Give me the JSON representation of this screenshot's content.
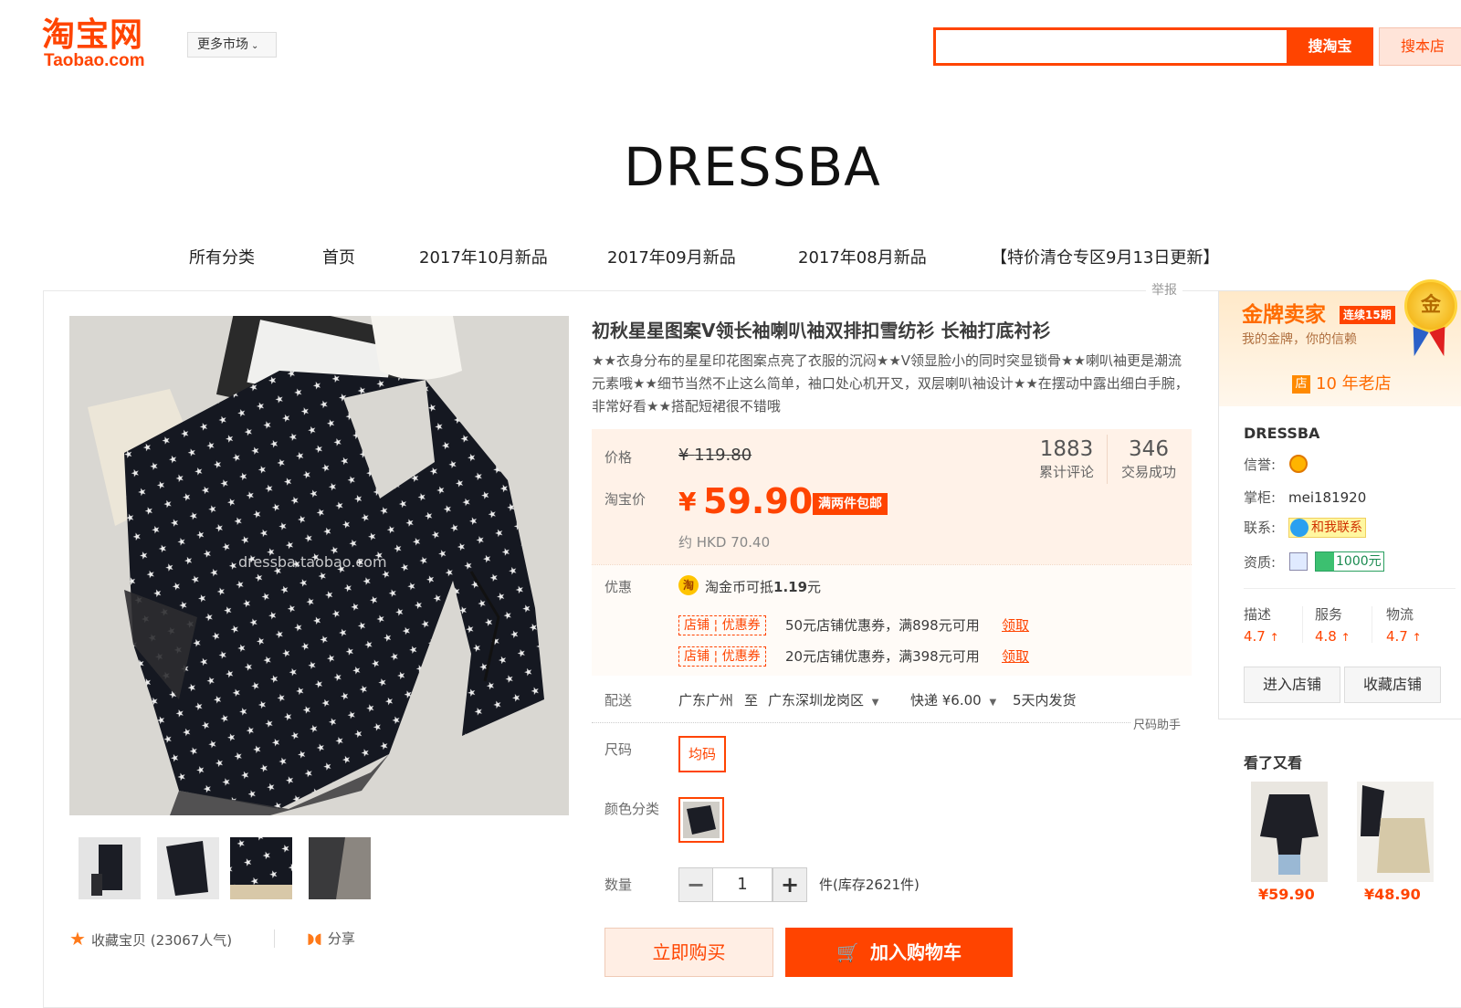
{
  "header": {
    "logo_cn": "淘宝网",
    "logo_en": "Taobao.com",
    "market_label": "更多市场",
    "search_value": "",
    "search_button": "搜淘宝",
    "search_shop_button": "搜本店"
  },
  "store": {
    "name": "DRESSBA",
    "nav": [
      "所有分类",
      "首页",
      "2017年10月新品",
      "2017年09月新品",
      "2017年08月新品",
      "【特价清仓专区9月13日更新】"
    ]
  },
  "report": "举报",
  "gallery": {
    "watermark": "dressba.taobao.com",
    "favorite_label": "收藏宝贝",
    "favorite_count": "(23067人气)",
    "share_label": "分享"
  },
  "product": {
    "title": "初秋星星图案V领长袖喇叭袖双排扣雪纺衫 长袖打底衬衫",
    "subtitle": "★★衣身分布的星星印花图案点亮了衣服的沉闷★★V领显脸小的同时突显锁骨★★喇叭袖更是潮流元素哦★★细节当然不止这么简单，袖口处心机开叉，双层喇叭袖设计★★在摆动中露出细白手腕，非常好看★★搭配短裙很不错哦",
    "price_label": "价格",
    "orig_currency": "¥",
    "orig_price": "119.80",
    "tb_price_label": "淘宝价",
    "currency": "¥",
    "price": "59.90",
    "free_ship_tag": "满两件包邮",
    "hkd": "约 HKD 70.40",
    "reviews_count": "1883",
    "reviews_label": "累计评论",
    "sales_count": "346",
    "sales_label": "交易成功",
    "promo_label": "优惠",
    "coin_icon_text": "淘",
    "coin_text_pre": "淘金币可抵",
    "coin_amount": "1.19",
    "coin_text_post": "元",
    "coupons": [
      {
        "tag_a": "店铺",
        "tag_b": "优惠券",
        "text": "50元店铺优惠券，满898元可用",
        "action": "领取"
      },
      {
        "tag_a": "店铺",
        "tag_b": "优惠券",
        "text": "20元店铺优惠券，满398元可用",
        "action": "领取"
      }
    ],
    "ship_label": "配送",
    "ship_from": "广东广州",
    "ship_to_word": "至",
    "ship_to": "广东深圳龙岗区",
    "ship_method": "快递 ¥6.00",
    "ship_time": "5天内发货",
    "size_helper": "尺码助手",
    "size_label": "尺码",
    "size_option": "均码",
    "color_label": "颜色分类",
    "qty_label": "数量",
    "qty_minus": "−",
    "qty_value": "1",
    "qty_plus": "+",
    "stock": "件(库存2621件)",
    "buy_now": "立即购买",
    "add_cart": "加入购物车"
  },
  "seller": {
    "gold_title": "金牌卖家",
    "streak": "连续15期",
    "gold_sub": "我的金牌，你的信赖",
    "medal_char": "金",
    "shop_icon": "店",
    "shop_age": "10 年老店",
    "shop_name": "DRESSBA",
    "credit_label": "信誉:",
    "owner_label": "掌柜:",
    "owner": "mei181920",
    "contact_label": "联系:",
    "contact_btn": "和我联系",
    "qual_label": "资质:",
    "deposit": "1000元",
    "ratings": [
      {
        "name": "描述",
        "score": "4.7"
      },
      {
        "name": "服务",
        "score": "4.8"
      },
      {
        "name": "物流",
        "score": "4.7"
      }
    ],
    "enter_shop": "进入店铺",
    "fav_shop": "收藏店铺"
  },
  "recommend": {
    "title": "看了又看",
    "items": [
      {
        "price": "¥59.90"
      },
      {
        "price": "¥48.90"
      }
    ]
  },
  "colors": {
    "accent": "#ff4400",
    "price_bg": "#fff2e8"
  }
}
